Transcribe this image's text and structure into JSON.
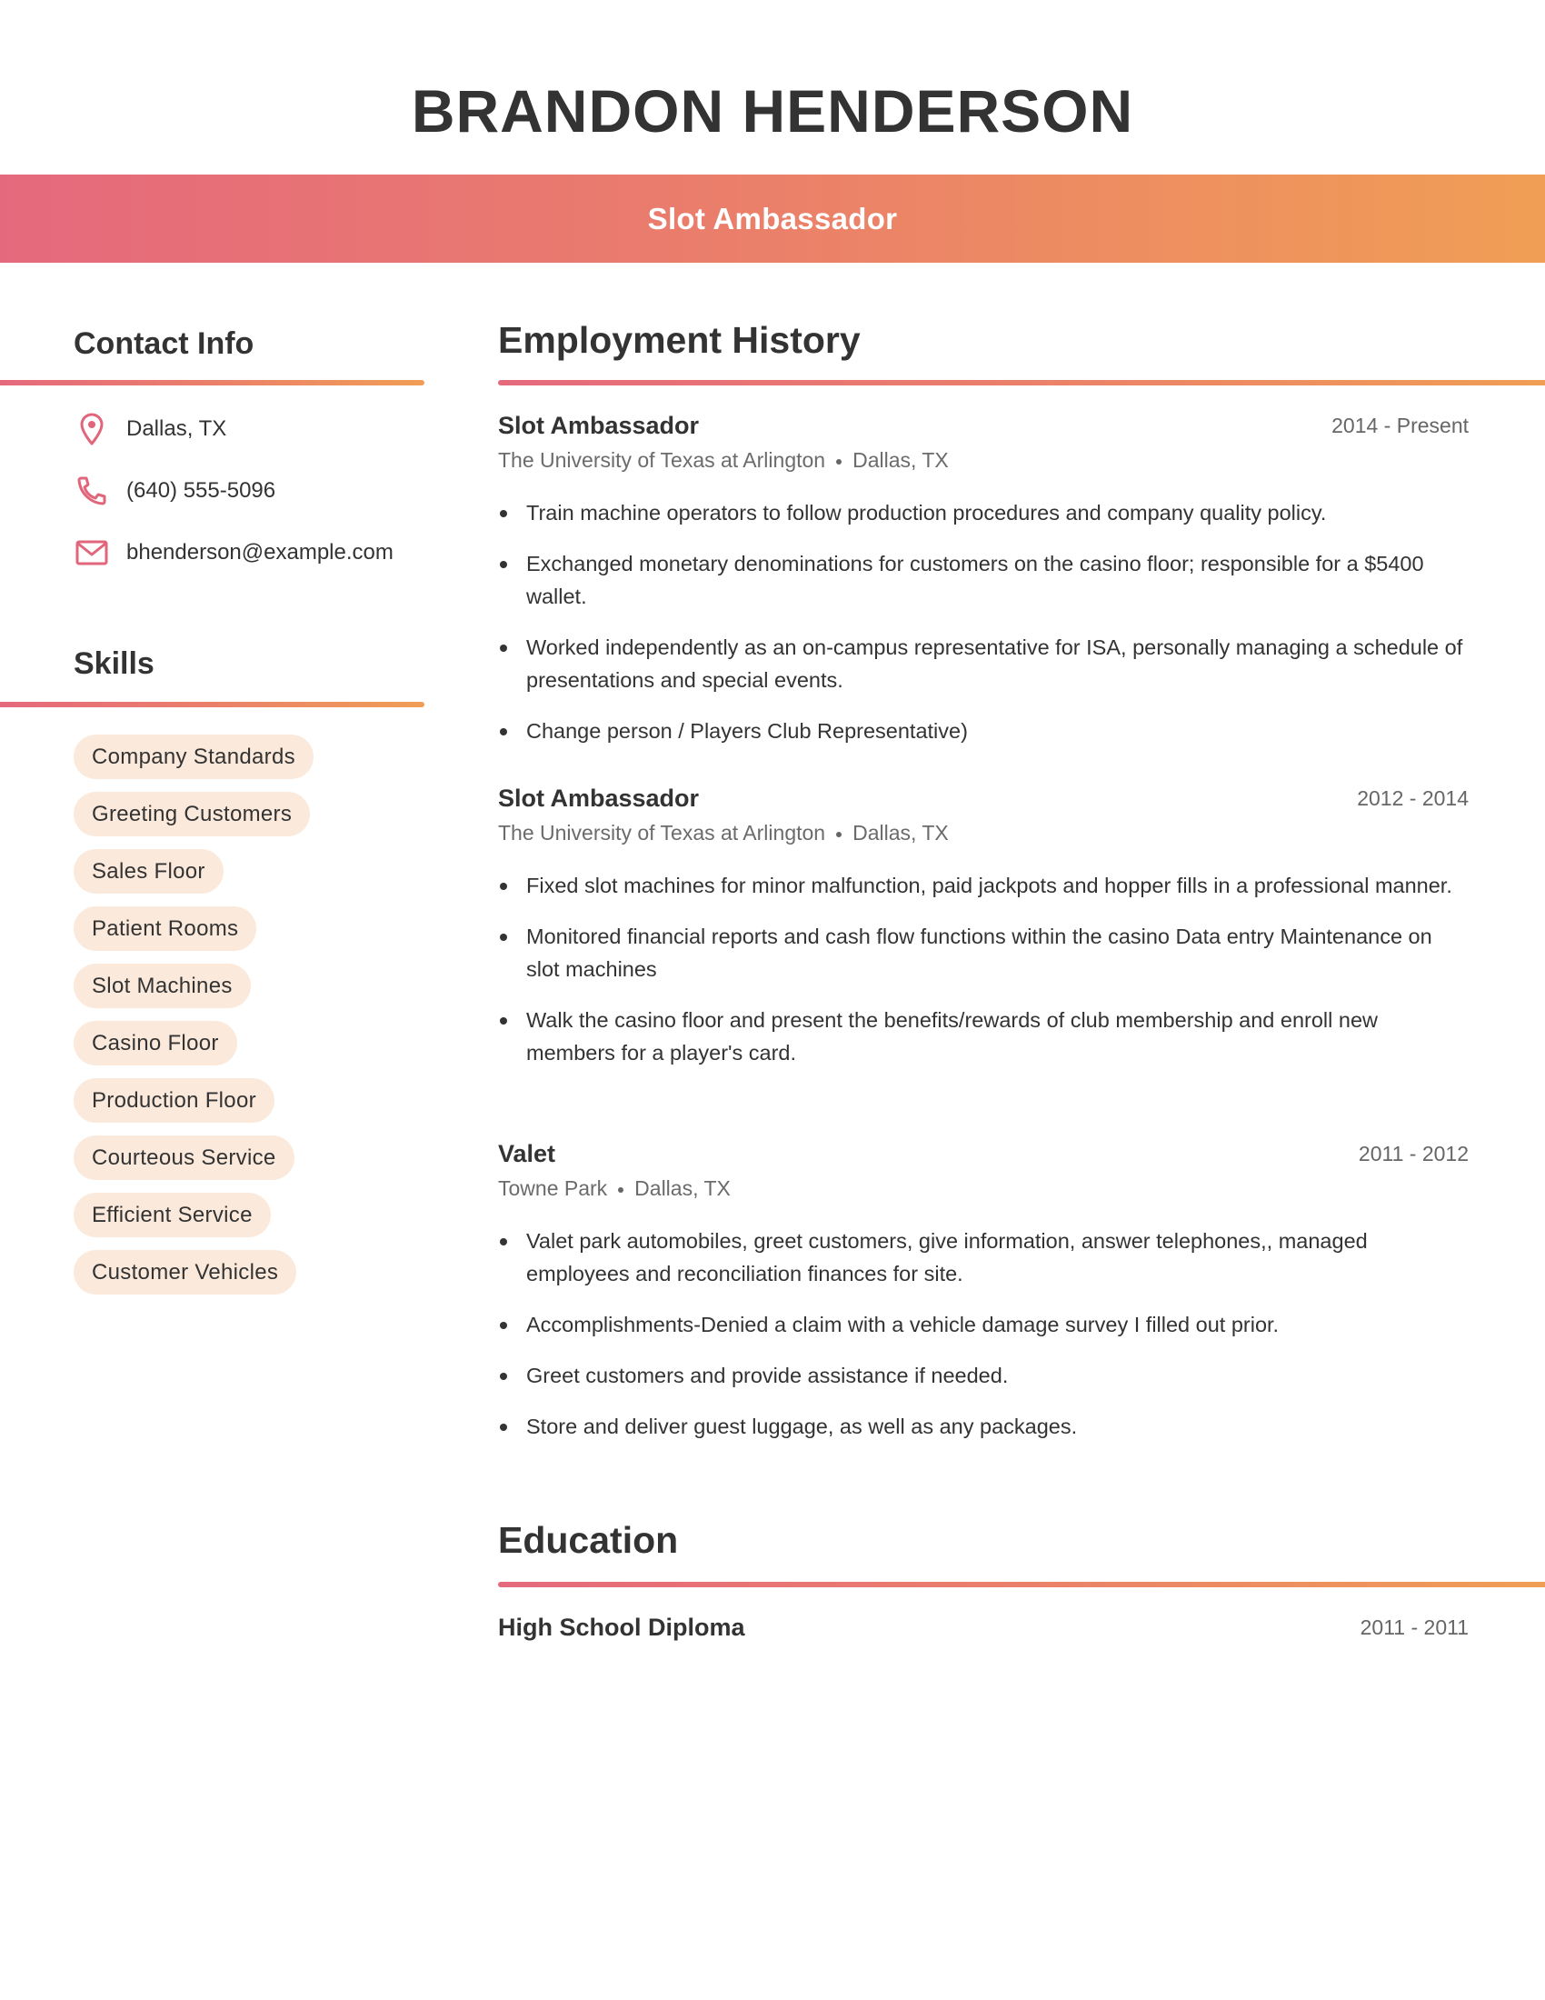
{
  "header": {
    "name": "BRANDON HENDERSON",
    "headline": "Slot Ambassador"
  },
  "theme": {
    "gradient_start": "#e5697d",
    "gradient_end": "#f09e55",
    "icon_color": "#e2667b",
    "pill_background": "#fbeadc",
    "text_color": "#333333"
  },
  "contact": {
    "heading": "Contact Info",
    "items": [
      {
        "icon": "location-pin-icon",
        "text": "Dallas, TX"
      },
      {
        "icon": "phone-icon",
        "text": "(640) 555-5096"
      },
      {
        "icon": "mail-icon",
        "text": "bhenderson@example.com"
      }
    ]
  },
  "skills": {
    "heading": "Skills",
    "items": [
      "Company Standards",
      "Greeting Customers",
      "Sales Floor",
      "Patient Rooms",
      "Slot Machines",
      "Casino Floor",
      "Production Floor",
      "Courteous Service",
      "Efficient Service",
      "Customer Vehicles"
    ]
  },
  "employment": {
    "heading": "Employment History",
    "jobs": [
      {
        "title": "Slot Ambassador",
        "dates": "2014 - Present",
        "company": "The University of Texas at Arlington",
        "location": "Dallas, TX",
        "bullets": [
          "Train machine operators to follow production procedures and company quality policy.",
          "Exchanged monetary denominations for customers on the casino floor; responsible for a $5400 wallet.",
          "Worked independently as an on-campus representative for ISA, personally managing a schedule of presentations and special events.",
          "Change person / Players Club Representative)"
        ]
      },
      {
        "title": "Slot Ambassador",
        "dates": "2012 - 2014",
        "company": "The University of Texas at Arlington",
        "location": "Dallas, TX",
        "bullets": [
          "Fixed slot machines for minor malfunction, paid jackpots and hopper fills in a professional manner.",
          "Monitored financial reports and cash flow functions within the casino Data entry Maintenance on slot machines",
          "Walk the casino floor and present the benefits/rewards of club membership and enroll new members for a player's card."
        ]
      },
      {
        "title": "Valet",
        "dates": "2011 - 2012",
        "company": "Towne Park",
        "location": "Dallas, TX",
        "bullets": [
          "Valet park automobiles, greet customers, give information, answer telephones,, managed employees and reconciliation finances for site.",
          "Accomplishments-Denied a claim with a vehicle damage survey I filled out prior.",
          "Greet customers and provide assistance if needed.",
          "Store and deliver guest luggage, as well as any packages."
        ]
      }
    ]
  },
  "education": {
    "heading": "Education",
    "items": [
      {
        "degree": "High School Diploma",
        "dates": "2011 - 2011"
      }
    ]
  }
}
